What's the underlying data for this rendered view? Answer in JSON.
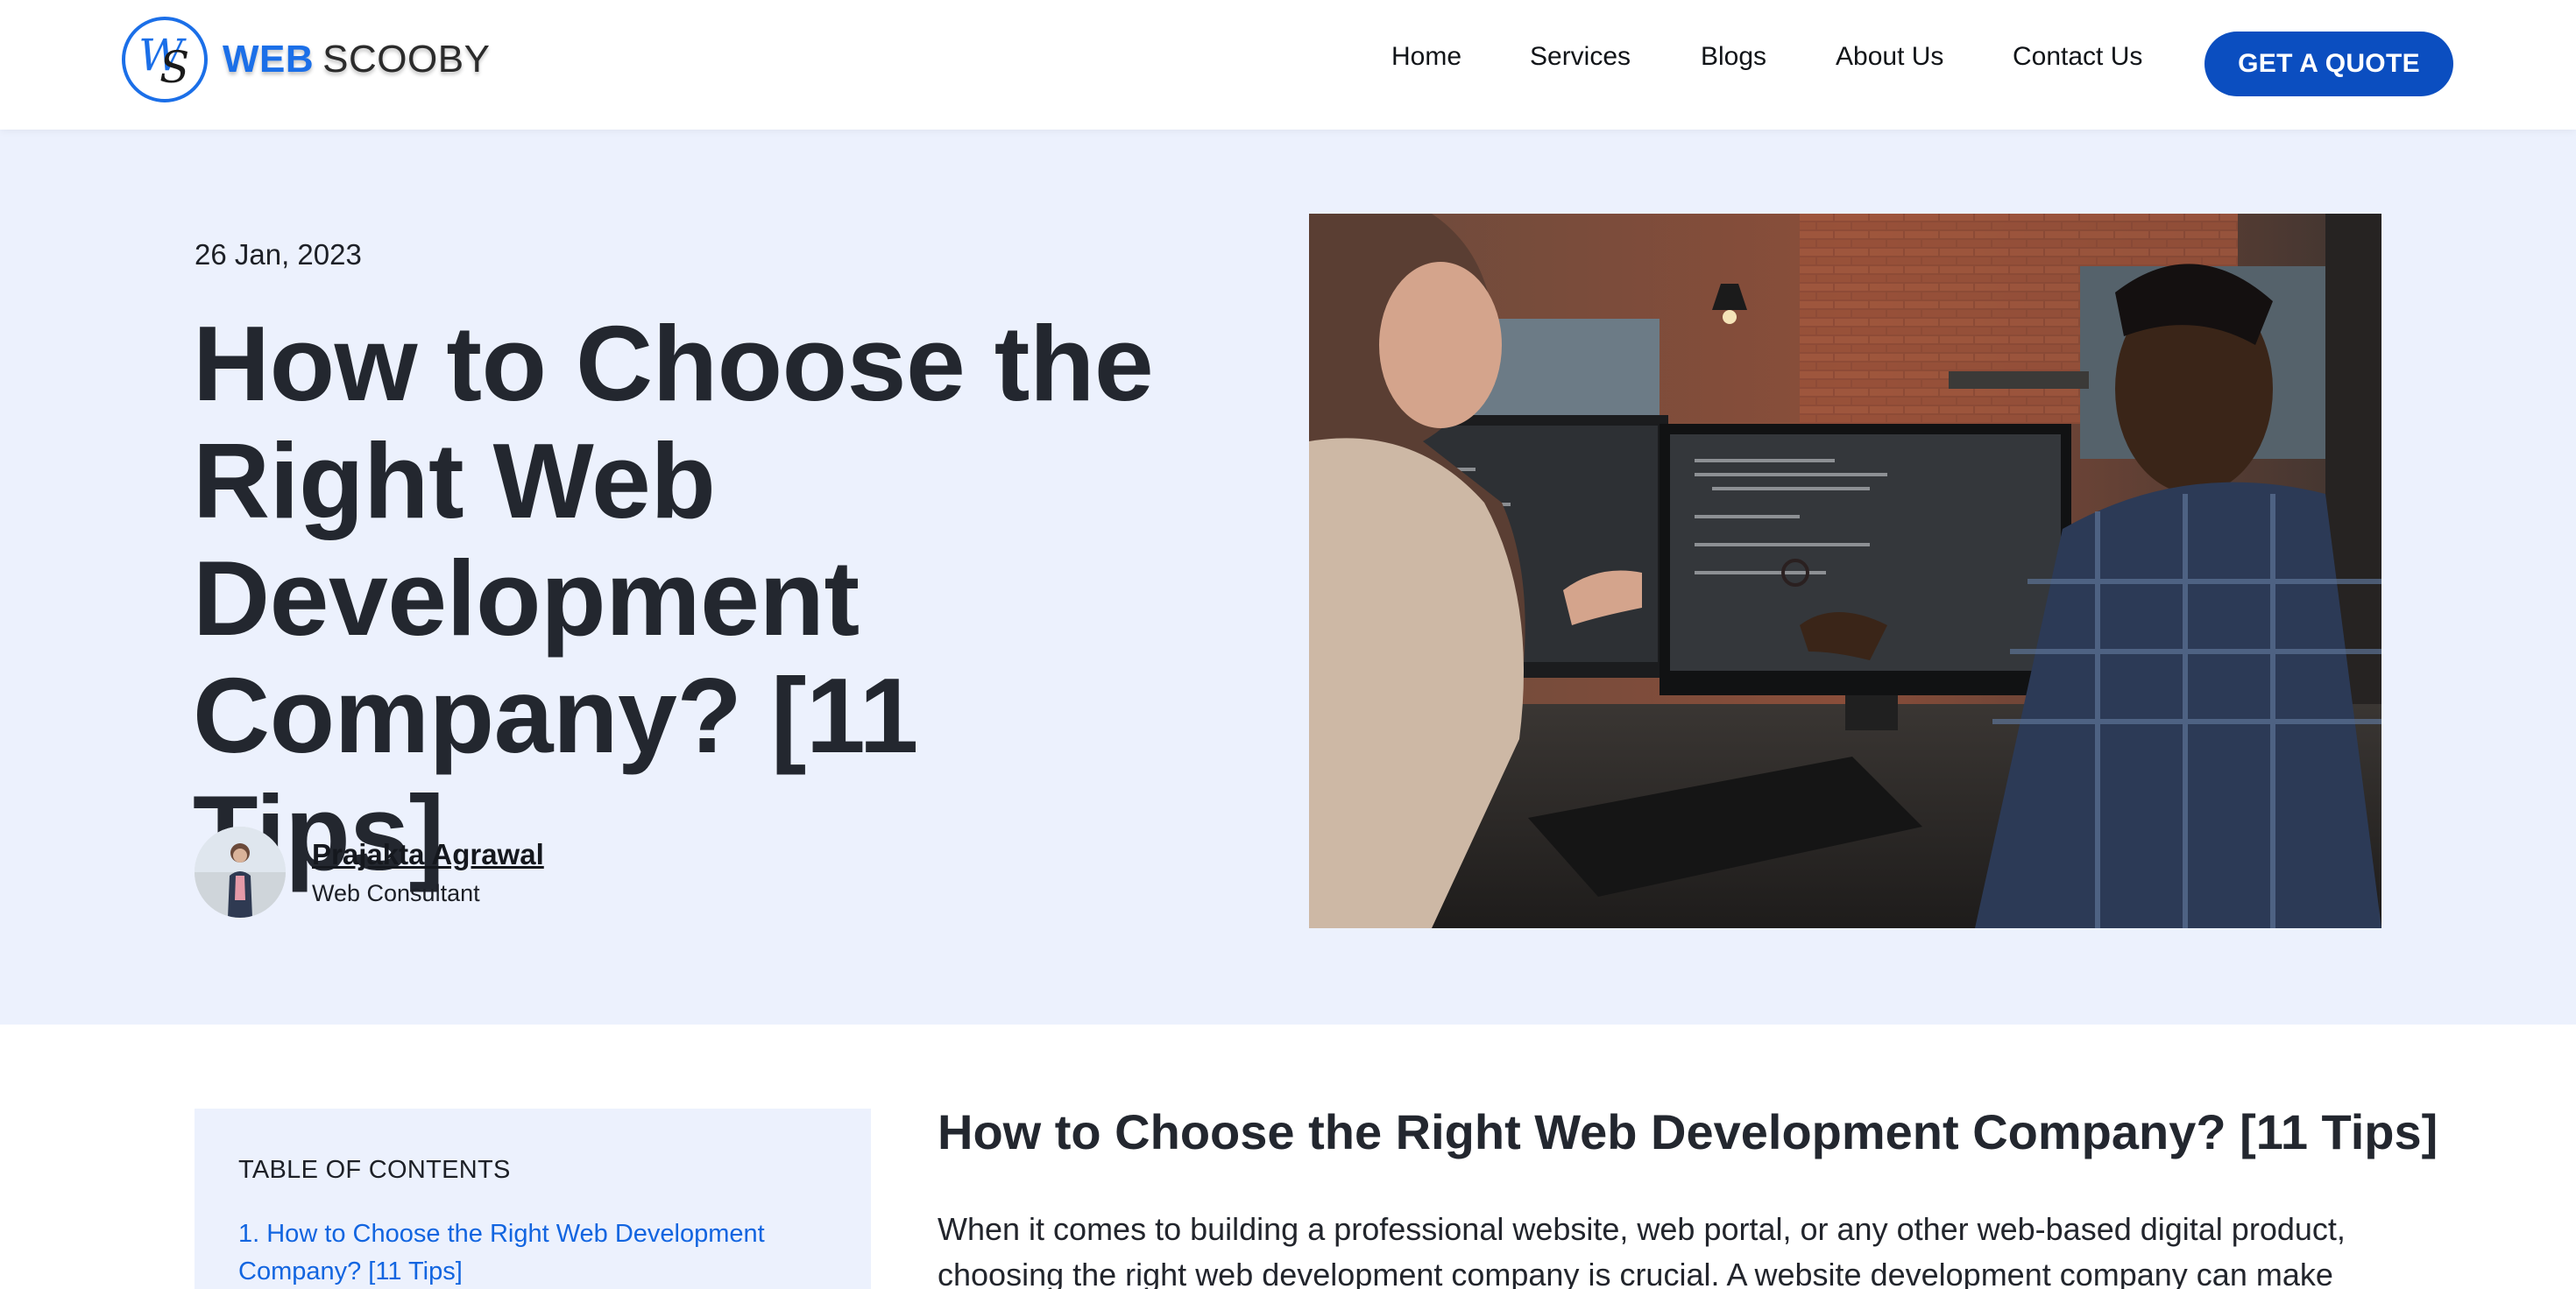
{
  "brand": {
    "logo_monogram": "WS",
    "name_part1": "WEB",
    "name_part2": "SCOOBY",
    "accent_color": "#1b6fe8"
  },
  "nav": {
    "items": [
      {
        "label": "Home"
      },
      {
        "label": "Services"
      },
      {
        "label": "Blogs"
      },
      {
        "label": "About Us"
      },
      {
        "label": "Contact Us"
      }
    ],
    "cta_label": "GET A QUOTE",
    "cta_color": "#0b4ec0"
  },
  "hero": {
    "date": "26 Jan, 2023",
    "title": "How to Choose the Right Web Development Company? [11 Tips]",
    "author_name": "Prajakta Agrawal",
    "author_role": "Web Consultant",
    "background_color": "#ecf1fd"
  },
  "toc": {
    "heading": "TABLE OF CONTENTS",
    "items": [
      {
        "label": "1. How to Choose the Right Web Development Company? [11 Tips]"
      }
    ]
  },
  "article": {
    "heading": "How to Choose the Right Web Development Company? [11 Tips]",
    "intro": "When it comes to building a professional website, web portal, or any other web-based digital product, choosing the right web development company is crucial. A website development company can make"
  }
}
